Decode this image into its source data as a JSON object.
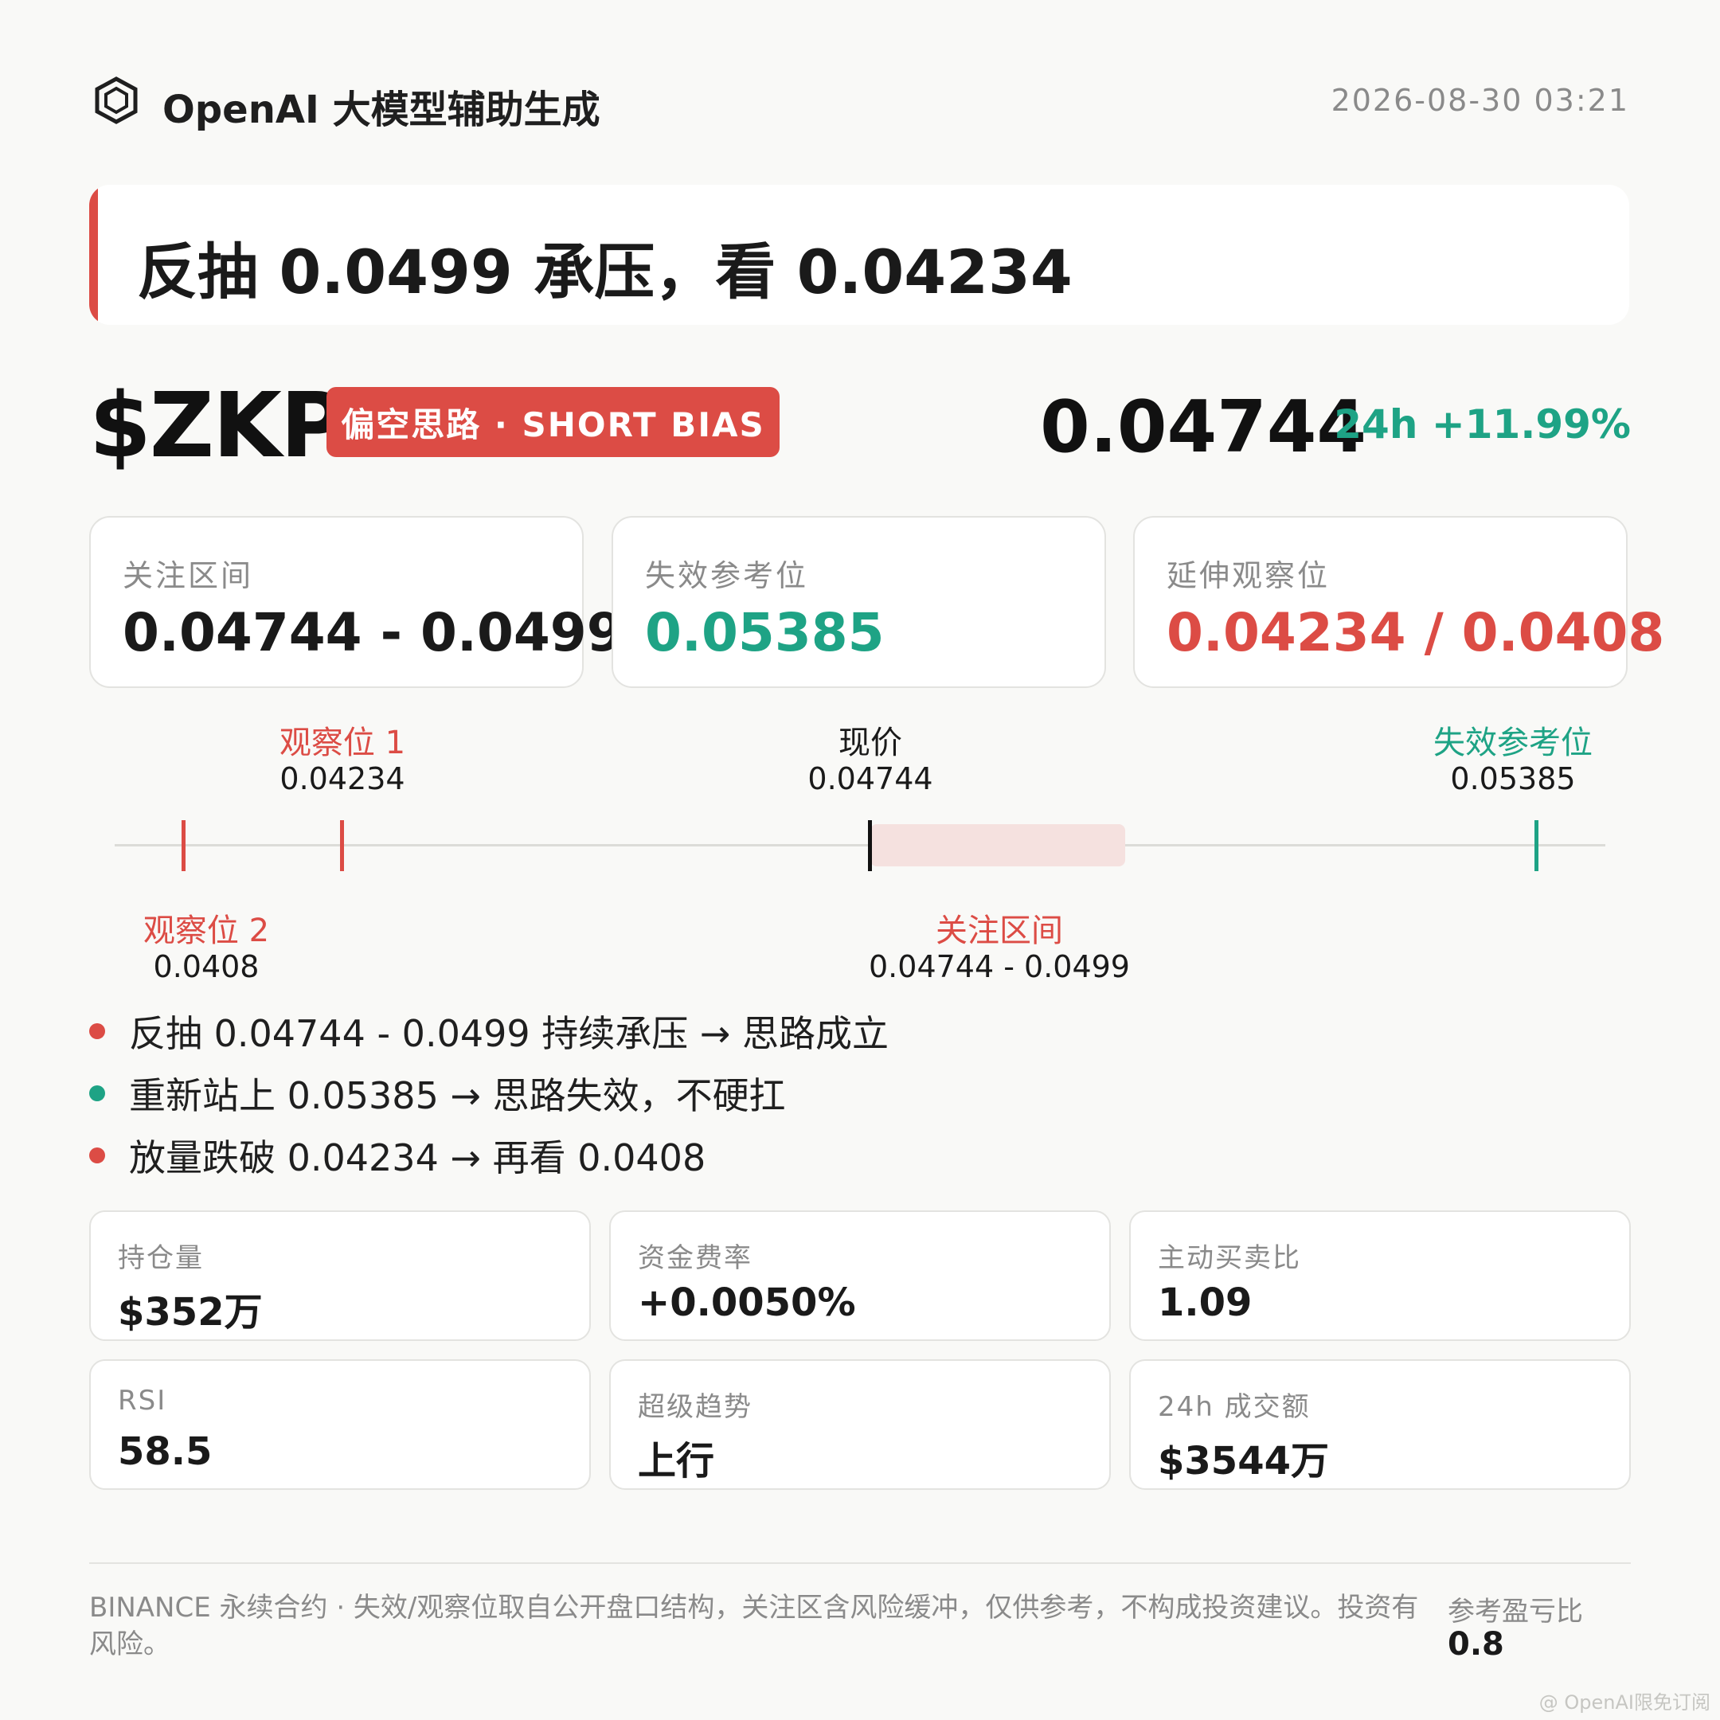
{
  "header": {
    "brand": "OpenAI 大模型辅助生成",
    "timestamp": "2026-08-30 03:21",
    "logo_icon": "hexagon-logo-icon"
  },
  "headline": "反抽 0.0499 承压，看 0.04234",
  "ticker": {
    "symbol": "$ZKP",
    "bias": "偏空思路 · SHORT BIAS",
    "price": "0.04744",
    "change": "24h +11.99%"
  },
  "levels": [
    {
      "label": "关注区间",
      "value": "0.04744 - 0.0499"
    },
    {
      "label": "失效参考位",
      "value": "0.05385"
    },
    {
      "label": "延伸观察位",
      "value": "0.04234 / 0.0408"
    }
  ],
  "ladder": {
    "watch1": {
      "name": "观察位 1",
      "value": "0.04234"
    },
    "current": {
      "name": "现价",
      "value": "0.04744"
    },
    "invalid": {
      "name": "失效参考位",
      "value": "0.05385"
    },
    "watch2": {
      "name": "观察位 2",
      "value": "0.0408"
    },
    "zone": {
      "name": "关注区间",
      "value": "0.04744 - 0.0499"
    }
  },
  "bullets": [
    "反抽 0.04744 - 0.0499 持续承压 → 思路成立",
    "重新站上 0.05385 → 思路失效，不硬扛",
    "放量跌破 0.04234 → 再看 0.0408"
  ],
  "metrics": [
    {
      "label": "持仓量",
      "value": "$352万"
    },
    {
      "label": "资金费率",
      "value": "+0.0050%"
    },
    {
      "label": "主动买卖比",
      "value": "1.09"
    },
    {
      "label": "RSI",
      "value": "58.5"
    },
    {
      "label": "超级趋势",
      "value": "上行"
    },
    {
      "label": "24h 成交额",
      "value": "$3544万"
    }
  ],
  "footer": {
    "disclaimer": "BINANCE 永续合约 · 失效/观察位取自公开盘口结构，关注区含风险缓冲，仅供参考，不构成投资建议。投资有风险。",
    "rr_label": "参考盈亏比",
    "rr_value": "0.8",
    "watermark": "@ OpenAI限免订阅"
  },
  "colors": {
    "red": "#dc4c45",
    "green": "#1ea385",
    "dark": "#1a1a1a"
  }
}
